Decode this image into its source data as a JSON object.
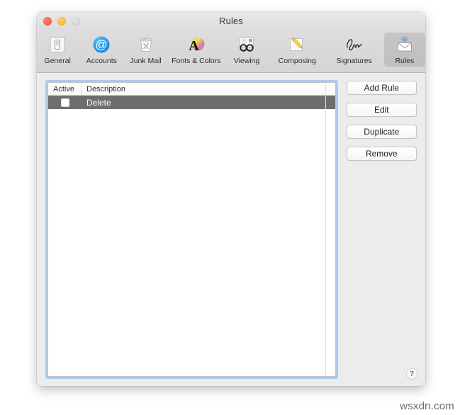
{
  "window": {
    "title": "Rules",
    "controls": [
      {
        "name": "close",
        "label": "Close"
      },
      {
        "name": "minimize",
        "label": "Minimize"
      },
      {
        "name": "zoom",
        "label": "Zoom"
      }
    ]
  },
  "toolbar": {
    "items": [
      {
        "label": "General",
        "icon": "switch-icon",
        "selected": false
      },
      {
        "label": "Accounts",
        "icon": "at-sign-icon",
        "selected": false
      },
      {
        "label": "Junk Mail",
        "icon": "trash-can-icon",
        "selected": false
      },
      {
        "label": "Fonts & Colors",
        "icon": "font-color-icon",
        "selected": false
      },
      {
        "label": "Viewing",
        "icon": "eyeglasses-icon",
        "selected": false
      },
      {
        "label": "Composing",
        "icon": "pencil-paper-icon",
        "selected": false
      },
      {
        "label": "Signatures",
        "icon": "signature-icon",
        "selected": false
      },
      {
        "label": "Rules",
        "icon": "rules-envelope-icon",
        "selected": true
      }
    ]
  },
  "table": {
    "columns": [
      "Active",
      "Description"
    ],
    "rows": [
      {
        "active": false,
        "description": "Delete",
        "selected": true
      }
    ]
  },
  "buttons": [
    {
      "label": "Add Rule"
    },
    {
      "label": "Edit"
    },
    {
      "label": "Duplicate"
    },
    {
      "label": "Remove"
    }
  ],
  "help": {
    "label": "?"
  },
  "watermark": {
    "text": "wsxdn.com"
  },
  "colors": {
    "selection_row": "#6e6e6e",
    "focus_ring": "#a8cbee",
    "accent_blue": "#4b7fd4",
    "window_bg": "#ececec"
  }
}
